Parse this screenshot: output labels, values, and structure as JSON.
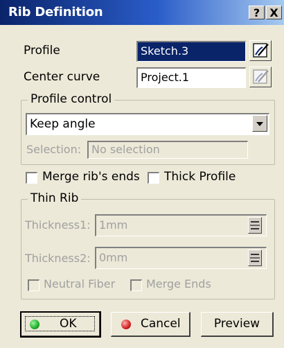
{
  "window": {
    "title": "Rib Definition",
    "help_label": "?",
    "close_label": "X"
  },
  "profile": {
    "label": "Profile",
    "value": "Sketch.3"
  },
  "center_curve": {
    "label": "Center curve",
    "value": "Project.1"
  },
  "profile_control": {
    "legend": "Profile control",
    "selected_option": "Keep angle",
    "selection_label": "Selection:",
    "selection_value": "No selection"
  },
  "options": {
    "merge_ribs_ends_label": "Merge rib's ends",
    "thick_profile_label": "Thick Profile"
  },
  "thin_rib": {
    "legend": "Thin Rib",
    "thickness1_label": "Thickness1:",
    "thickness1_value": "1mm",
    "thickness2_label": "Thickness2:",
    "thickness2_value": "0mm",
    "neutral_fiber_label": "Neutral Fiber",
    "merge_ends_label": "Merge Ends"
  },
  "buttons": {
    "ok_label": "OK",
    "cancel_label": "Cancel",
    "preview_label": "Preview"
  },
  "colors": {
    "titlebar": "#0a246a",
    "ok_icon": "#1fae2a",
    "cancel_icon": "#d42020"
  }
}
